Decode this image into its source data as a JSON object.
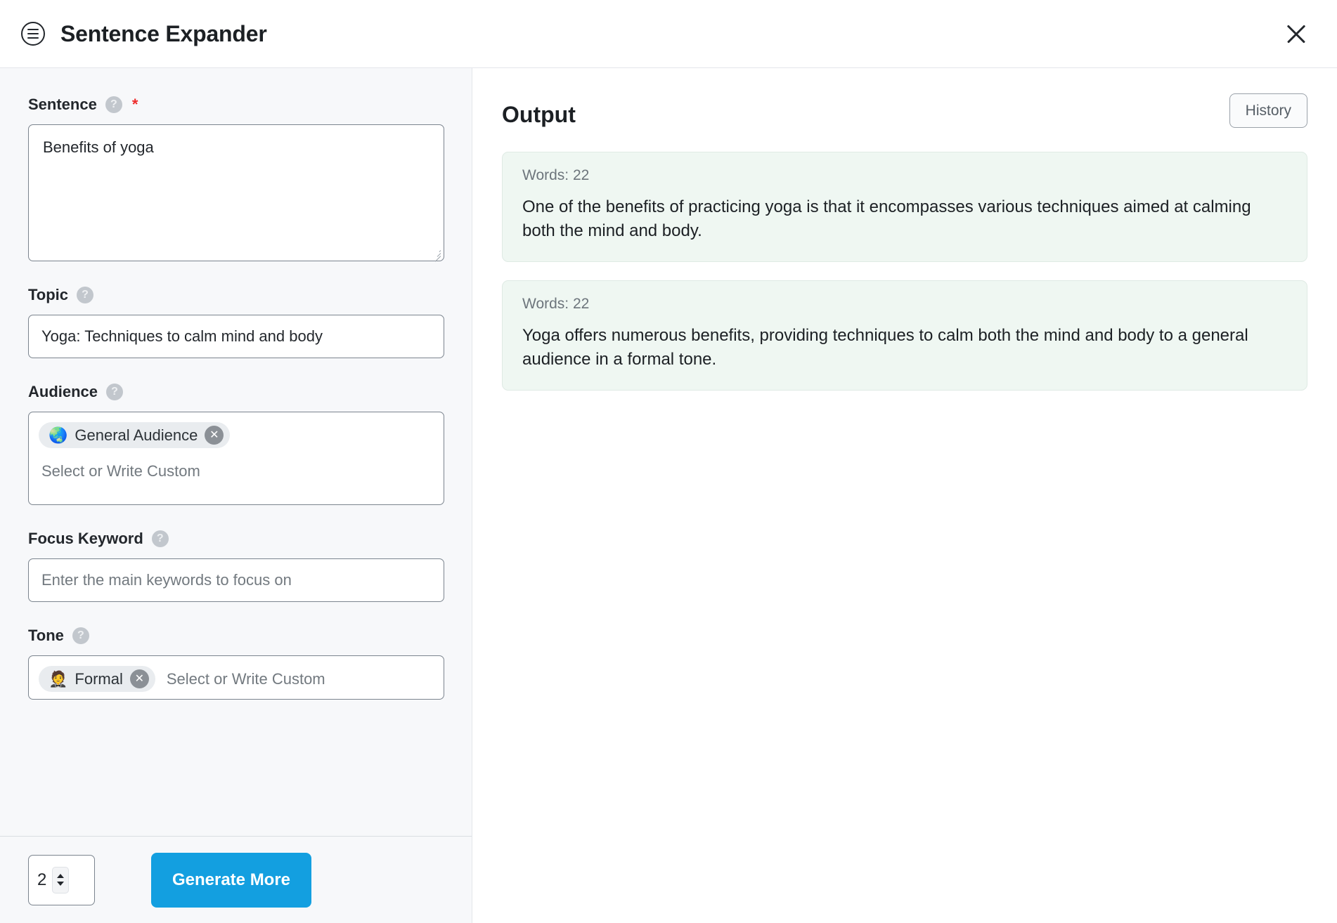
{
  "header": {
    "menu_icon": "hamburger-circle-icon",
    "title": "Sentence Expander",
    "close_icon": "close-icon"
  },
  "form": {
    "sentence": {
      "label": "Sentence",
      "help_icon": "question-mark-icon",
      "required_mark": "*",
      "value": "Benefits of yoga"
    },
    "topic": {
      "label": "Topic",
      "help_icon": "question-mark-icon",
      "value": "Yoga: Techniques to calm mind and body"
    },
    "audience": {
      "label": "Audience",
      "help_icon": "question-mark-icon",
      "chips": [
        {
          "emoji": "🌏",
          "label": "General Audience",
          "remove_icon": "close-circle-icon"
        }
      ],
      "placeholder": "Select or Write Custom"
    },
    "focus_keyword": {
      "label": "Focus Keyword",
      "help_icon": "question-mark-icon",
      "value": "",
      "placeholder": "Enter the main keywords to focus on"
    },
    "tone": {
      "label": "Tone",
      "help_icon": "question-mark-icon",
      "chips": [
        {
          "emoji": "🤵",
          "label": "Formal",
          "remove_icon": "close-circle-icon"
        }
      ],
      "placeholder": "Select or Write Custom"
    }
  },
  "actionbar": {
    "count_value": "2",
    "stepper_up_icon": "chevron-up-icon",
    "stepper_down_icon": "chevron-down-icon",
    "generate_label": "Generate More"
  },
  "output": {
    "title": "Output",
    "history_label": "History",
    "results": [
      {
        "words_label": "Words: 22",
        "text": "One of the benefits of practicing yoga is that it encompasses various techniques aimed at calming both the mind and body."
      },
      {
        "words_label": "Words: 22",
        "text": "Yoga offers numerous benefits, providing techniques to calm both the mind and body to a general audience in a formal tone."
      }
    ]
  },
  "colors": {
    "accent": "#139fe0",
    "required": "#ee2b2b",
    "panel_bg": "#f7f8fa",
    "card_bg": "#eff7f2"
  }
}
